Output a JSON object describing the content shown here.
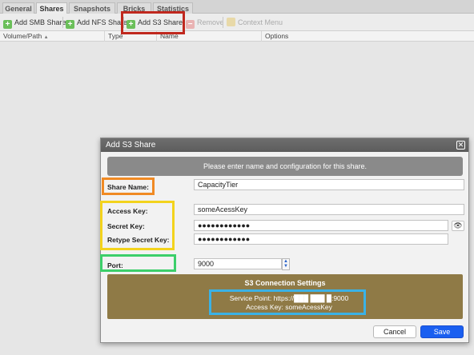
{
  "tabs": [
    "General",
    "Shares",
    "Snapshots",
    "Bricks",
    "Statistics"
  ],
  "active_tab": "Shares",
  "toolbar": {
    "add_smb": "Add SMB Share",
    "add_nfs": "Add NFS Share",
    "add_s3": "Add S3 Share",
    "remove": "Remove",
    "context_menu": "Context Menu"
  },
  "columns": [
    "Volume/Path",
    "Type",
    "Name",
    "Options"
  ],
  "dialog": {
    "title": "Add S3 Share",
    "close_glyph": "✕",
    "banner": "Please enter name and configuration for this share.",
    "share_name_label": "Share Name:",
    "share_name_value": "CapacityTier",
    "access_key_label": "Access Key:",
    "access_key_value": "someAcessKey",
    "secret_key_label": "Secret Key:",
    "secret_key_value": "●●●●●●●●●●●●",
    "retype_label": "Retype Secret Key:",
    "retype_value": "●●●●●●●●●●●●",
    "port_label": "Port:",
    "port_value": "9000",
    "s3_settings_title": "S3 Connection Settings",
    "service_point": "Service Point: https://███ ███ █:9000",
    "access_key_info": "Access Key: someAcessKey",
    "cancel": "Cancel",
    "save": "Save"
  },
  "colors": {
    "accent_blue": "#1a5ff0",
    "s3_panel": "#8f7a46",
    "highlight_red": "#c0281e",
    "highlight_orange": "#f08a24",
    "highlight_yellow": "#f3d31d",
    "highlight_green": "#3ccf6a",
    "highlight_blue": "#3ab2e6"
  }
}
